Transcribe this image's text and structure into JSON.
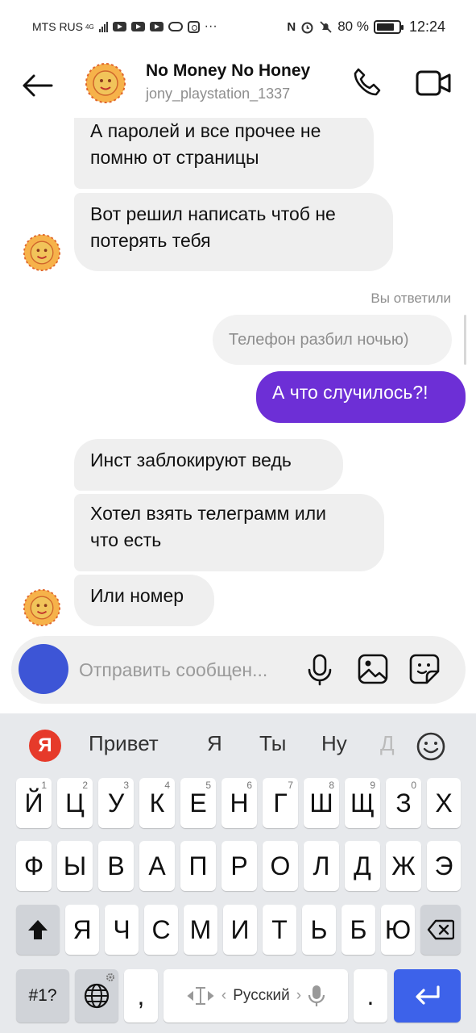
{
  "status_bar": {
    "carrier": "MTS RUS",
    "network": "4G",
    "battery": "80 %",
    "time": "12:24"
  },
  "header": {
    "title": "No Money No Honey",
    "username": "jony_playstation_1337"
  },
  "messages": [
    {
      "text": "А паролей и все прочее не помню от страницы",
      "line1": "А паролей и все прочее не",
      "line2": "помню от страницы"
    },
    {
      "text": "Вот решил написать чтоб не потерять тебя",
      "line1": "Вот решил написать чтоб не",
      "line2": "потерять тебя"
    },
    {
      "reply_label": "Вы ответили",
      "quoted": "Телефон разбил ночью)"
    },
    {
      "text": "А что случилось?!"
    },
    {
      "text": "Инст заблокируют ведь"
    },
    {
      "text": "Хотел взять телеграмм или что есть",
      "line1": "Хотел взять телеграмм или",
      "line2": "что есть"
    },
    {
      "text": "Или номер"
    }
  ],
  "composer": {
    "placeholder": "Отправить сообщен..."
  },
  "keyboard": {
    "logo": "Я",
    "suggestions": [
      "Привет",
      "Я",
      "Ты",
      "Ну",
      "Д"
    ],
    "row1": [
      "Й",
      "Ц",
      "У",
      "К",
      "Е",
      "Н",
      "Г",
      "Ш",
      "Щ",
      "З",
      "Х"
    ],
    "row1_hints": [
      "1",
      "2",
      "3",
      "4",
      "5",
      "6",
      "7",
      "8",
      "9",
      "0",
      ""
    ],
    "row2": [
      "Ф",
      "Ы",
      "В",
      "А",
      "П",
      "Р",
      "О",
      "Л",
      "Д",
      "Ж",
      "Э"
    ],
    "row3": [
      "Я",
      "Ч",
      "С",
      "М",
      "И",
      "Т",
      "Ь",
      "Б",
      "Ю"
    ],
    "symbols_label": "#1?",
    "comma": ",",
    "period": ".",
    "language": "Русский"
  },
  "colors": {
    "accent": "#6d2fd6",
    "camera": "#3d55d6",
    "enter": "#3d62ea",
    "bubble_in": "#efefef",
    "keyboard_bg": "#e7e9ec"
  }
}
